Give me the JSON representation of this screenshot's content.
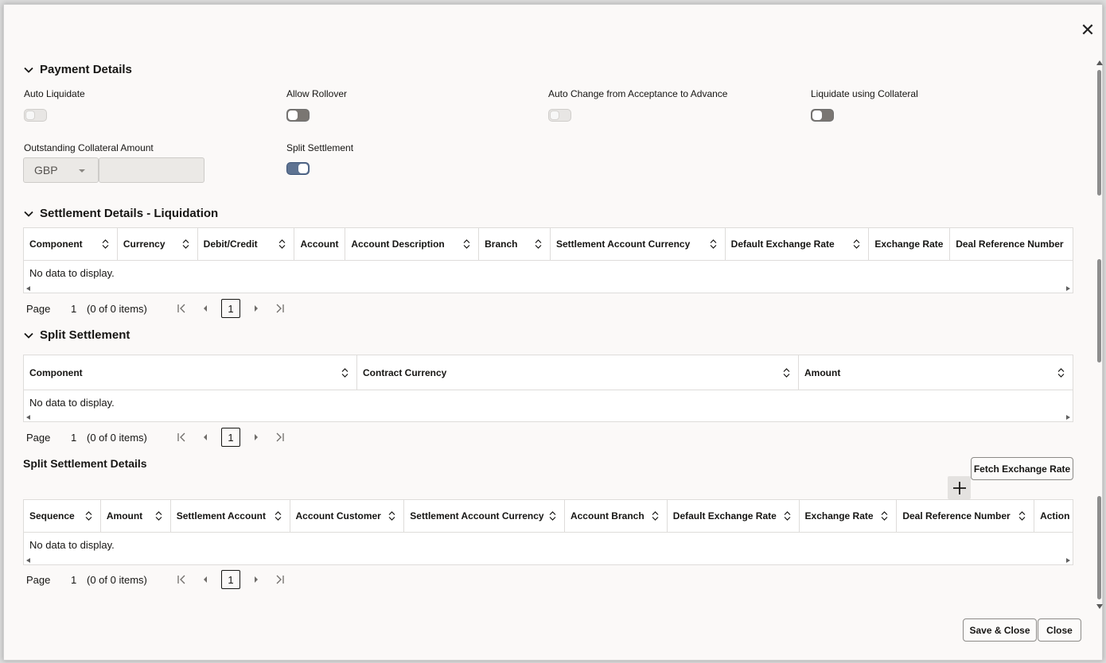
{
  "payment_details": {
    "title": "Payment Details",
    "auto_liquidate": {
      "label": "Auto Liquidate",
      "state": "off-disabled"
    },
    "allow_rollover": {
      "label": "Allow Rollover",
      "state": "off"
    },
    "auto_change": {
      "label": "Auto Change from Acceptance to Advance",
      "state": "off-disabled"
    },
    "liquidate_collateral": {
      "label": "Liquidate using Collateral",
      "state": "off"
    },
    "outstanding_collateral": {
      "label": "Outstanding Collateral Amount",
      "currency": "GBP",
      "amount": ""
    },
    "split_settlement": {
      "label": "Split Settlement",
      "state": "on"
    }
  },
  "settlement_liquidation": {
    "title": "Settlement Details - Liquidation",
    "columns": [
      "Component",
      "Currency",
      "Debit/Credit",
      "Account",
      "Account Description",
      "Branch",
      "Settlement Account Currency",
      "Default Exchange Rate",
      "Exchange Rate",
      "Deal Reference Number"
    ],
    "no_data": "No data to display.",
    "pager": {
      "label": "Page",
      "page": "1",
      "items": "(0 of 0 items)",
      "current": "1"
    }
  },
  "split_settlement": {
    "title": "Split Settlement",
    "columns": [
      "Component",
      "Contract Currency",
      "Amount"
    ],
    "no_data": "No data to display.",
    "pager": {
      "label": "Page",
      "page": "1",
      "items": "(0 of 0 items)",
      "current": "1"
    }
  },
  "split_settlement_details": {
    "title": "Split Settlement Details",
    "fetch_button": "Fetch Exchange Rate",
    "add_icon": "plus-icon",
    "columns": [
      "Sequence",
      "Amount",
      "Settlement Account",
      "Account Customer",
      "Settlement Account Currency",
      "Account Branch",
      "Default Exchange Rate",
      "Exchange Rate",
      "Deal Reference Number",
      "Action"
    ],
    "no_data": "No data to display.",
    "pager": {
      "label": "Page",
      "page": "1",
      "items": "(0 of 0 items)",
      "current": "1"
    }
  },
  "footer": {
    "save_close": "Save & Close",
    "close": "Close"
  },
  "colors": {
    "toggle_on": "#5e7392",
    "toggle_off": "#7a7672",
    "panel": "#fbf9f8"
  }
}
